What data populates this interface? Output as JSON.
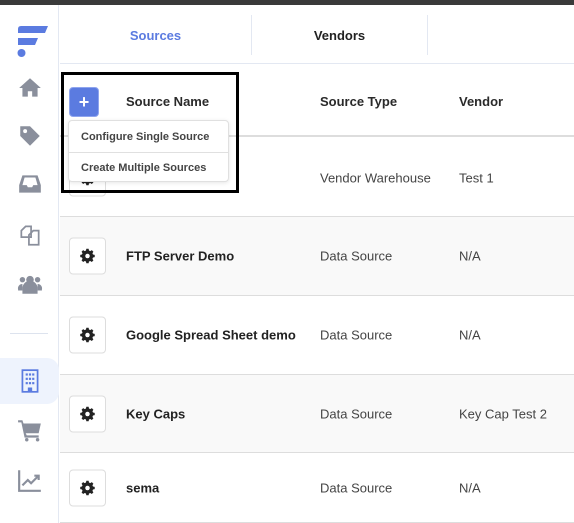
{
  "colors": {
    "accent": "#5b7be0",
    "icon_gray": "#8a8f9c"
  },
  "sidebar": {
    "items": [
      {
        "icon": "home-icon"
      },
      {
        "icon": "tag-icon"
      },
      {
        "icon": "inbox-icon"
      },
      {
        "icon": "copy-icon"
      },
      {
        "icon": "users-icon"
      },
      {
        "icon": "building-icon",
        "active": true
      },
      {
        "icon": "cart-icon"
      },
      {
        "icon": "chart-line-icon"
      }
    ]
  },
  "tabs": [
    {
      "label": "Sources",
      "active": true
    },
    {
      "label": "Vendors"
    }
  ],
  "table": {
    "headers": [
      "Source Name",
      "Source Type",
      "Vendor"
    ],
    "add_menu": [
      "Configure Single Source",
      "Create Multiple Sources"
    ],
    "rows": [
      {
        "name": "",
        "type": "Vendor Warehouse",
        "vendor": "Test 1"
      },
      {
        "name": "FTP Server Demo",
        "type": "Data Source",
        "vendor": "N/A"
      },
      {
        "name": "Google Spread Sheet demo",
        "type": "Data Source",
        "vendor": "N/A"
      },
      {
        "name": "Key Caps",
        "type": "Data Source",
        "vendor": "Key Cap Test 2"
      },
      {
        "name": "sema",
        "type": "Data Source",
        "vendor": "N/A"
      }
    ]
  }
}
